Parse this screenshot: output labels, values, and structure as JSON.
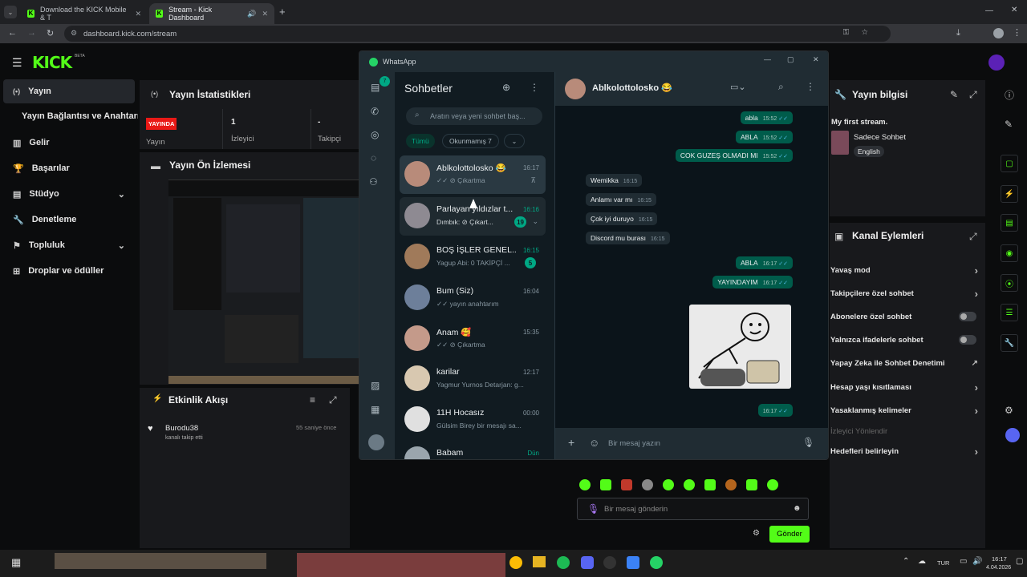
{
  "browser": {
    "tabs": [
      {
        "title": "Download the KICK Mobile & T"
      },
      {
        "title": "Stream - Kick Dashboard"
      }
    ],
    "url": "dashboard.kick.com/stream"
  },
  "kick": {
    "logo": "KICK",
    "logo_badge": "BETA",
    "sidebar": [
      {
        "label": "Yayın"
      },
      {
        "label": "Yayın Bağlantısı ve Anahtarı"
      },
      {
        "label": "Gelir"
      },
      {
        "label": "Başarılar"
      },
      {
        "label": "Stüdyo"
      },
      {
        "label": "Denetleme"
      },
      {
        "label": "Topluluk"
      },
      {
        "label": "Droplar ve ödüller"
      }
    ],
    "stats": {
      "title": "Yayın İstatistikleri",
      "live_badge": "YAYINDA",
      "live_label": "Yayın",
      "viewers_value": "1",
      "viewers_label": "İzleyici",
      "followers_value": "-",
      "followers_label": "Takipçi"
    },
    "preview": {
      "title": "Yayın Ön İzlemesi"
    },
    "activity": {
      "title": "Etkinlik Akışı",
      "items": [
        {
          "user": "Burodu38",
          "action": "kanalı takip etti",
          "time": "55 saniye önce"
        }
      ]
    },
    "info": {
      "title": "Yayın bilgisi",
      "stream_title": "My first stream.",
      "category": "Sadece Sohbet",
      "language": "English"
    },
    "actions": {
      "title": "Kanal Eylemleri",
      "items": [
        {
          "label": "Yavaş mod",
          "control": "chevron"
        },
        {
          "label": "Takipçilere özel sohbet",
          "control": "chevron"
        },
        {
          "label": "Abonelere özel sohbet",
          "control": "toggle"
        },
        {
          "label": "Yalnızca ifadelerle sohbet",
          "control": "toggle"
        },
        {
          "label": "Yapay Zeka ile Sohbet Denetimi",
          "control": "external"
        },
        {
          "label": "Hesap yaşı kısıtlaması",
          "control": "chevron"
        },
        {
          "label": "Yasaklanmış kelimeler",
          "control": "chevron"
        }
      ],
      "disabled_item": "İzleyici Yönlendir",
      "targets": "Hedefleri belirleyin"
    },
    "chat": {
      "placeholder": "Bir mesaj gönderin",
      "send": "Gönder"
    }
  },
  "whatsapp": {
    "window_title": "WhatsApp",
    "rail_badge": "7",
    "list_title": "Sohbetler",
    "search_placeholder": "Aratın veya yeni sohbet baş...",
    "filters": {
      "all": "Tümü",
      "unread": "Okunmamış 7"
    },
    "chats": [
      {
        "name": "Ablkolottolosko 😂",
        "time": "16:17",
        "preview": "✓✓ ⊘ Çıkartma",
        "badge": ""
      },
      {
        "name": "Parlayan yıldızlar t...",
        "time": "16:16",
        "preview": "Dımbık: ⊘ Çıkart...",
        "badge": "19"
      },
      {
        "name": "BOŞ İŞLER GENEL...",
        "time": "16:15",
        "preview": "Yagup Abi: 0 TAKİPÇİ ...",
        "badge": "5"
      },
      {
        "name": "Bum (Siz)",
        "time": "16:04",
        "preview": "✓✓ yayın anahtarım",
        "badge": ""
      },
      {
        "name": "Anam 🥰",
        "time": "15:35",
        "preview": "✓✓ ⊘ Çıkartma",
        "badge": ""
      },
      {
        "name": "karilar",
        "time": "12:17",
        "preview": "Yagmur Yurnos Detarjan: g...",
        "badge": ""
      },
      {
        "name": "11H Hocasız",
        "time": "00:00",
        "preview": "Gülsim Birey bir mesajı sa...",
        "badge": ""
      },
      {
        "name": "Babam",
        "time": "Dün",
        "preview": "",
        "badge": ""
      }
    ],
    "contact": "Ablkolottolosko 😂",
    "messages": [
      {
        "dir": "out",
        "text": "abla",
        "time": "15:52"
      },
      {
        "dir": "out",
        "text": "ABLA",
        "time": "15:52"
      },
      {
        "dir": "out",
        "text": "COK GUZEŞ OLMADI MI",
        "time": "15:52"
      },
      {
        "dir": "in",
        "text": "Wemikka",
        "time": "16:15"
      },
      {
        "dir": "in",
        "text": "Anlamı var mı",
        "time": "16:15"
      },
      {
        "dir": "in",
        "text": "Çok iyi duruyo",
        "time": "16:15"
      },
      {
        "dir": "in",
        "text": "Discord mu burası",
        "time": "16:15"
      },
      {
        "dir": "out",
        "text": "ABLA",
        "time": "16:17"
      },
      {
        "dir": "out",
        "text": "YAYINDAYIM",
        "time": "16:17"
      }
    ],
    "sticker_time": "16:17",
    "composer_placeholder": "Bir mesaj yazın"
  },
  "taskbar": {
    "lang": "TUR",
    "time": "16:17",
    "date": "4.04.2026"
  },
  "colors": {
    "kick_green": "#53fc18",
    "wa_green": "#00a884",
    "wa_bubble_out": "#005c4b"
  }
}
